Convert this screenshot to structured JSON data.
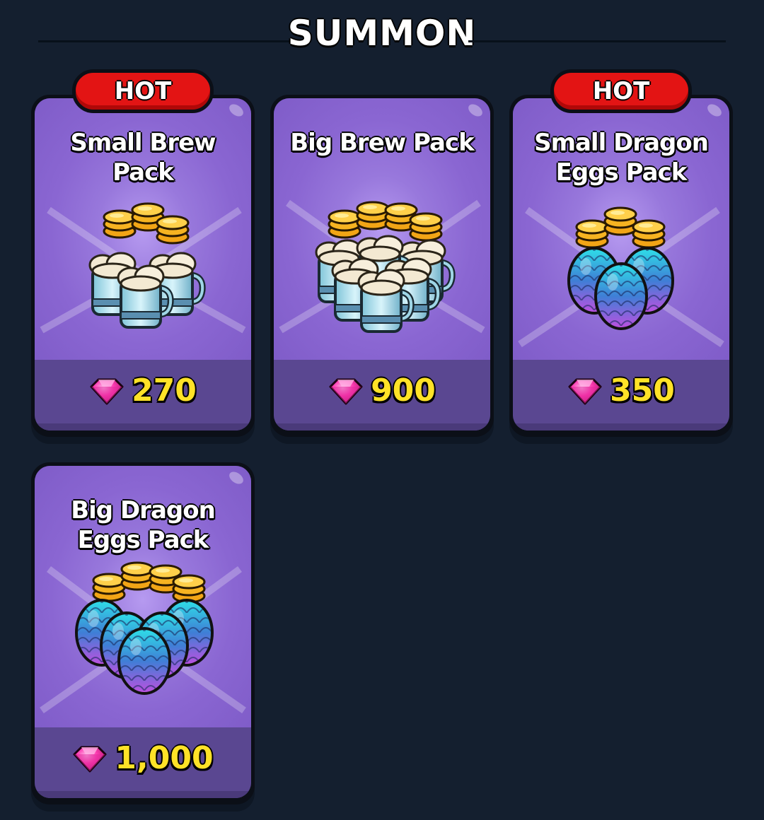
{
  "section": {
    "title": "SUMMON"
  },
  "packs": [
    {
      "badge": "HOT",
      "title": "Small Brew Pack",
      "price": "270",
      "currency_icon": "gem-icon",
      "art": "beer-mugs-coins"
    },
    {
      "badge": "",
      "title": "Big Brew Pack",
      "price": "900",
      "currency_icon": "gem-icon",
      "art": "many-beer-mugs-coins"
    },
    {
      "badge": "HOT",
      "title": "Small Dragon Eggs Pack",
      "price": "350",
      "currency_icon": "gem-icon",
      "art": "dragon-eggs-coins"
    },
    {
      "badge": "",
      "title": "Big Dragon Eggs Pack",
      "price": "1,000",
      "currency_icon": "gem-icon",
      "art": "many-dragon-eggs-coins"
    }
  ],
  "colors": {
    "background": "#141f2f",
    "card_purple": "#8a66d2",
    "price_bar": "#5a4791",
    "price_text": "#ffe227",
    "hot_badge": "#e31414",
    "gem": "#ff3fb4"
  }
}
